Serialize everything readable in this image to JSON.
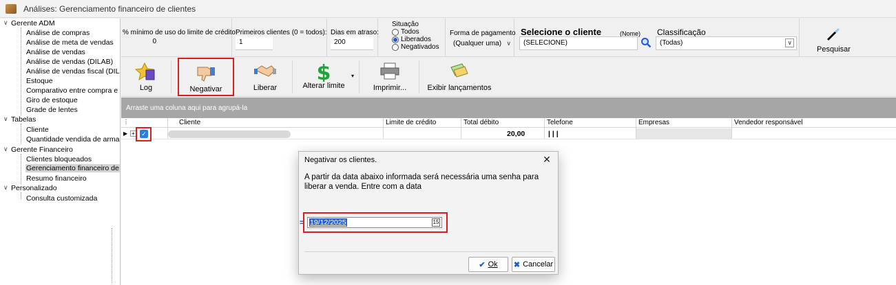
{
  "window": {
    "title": "Análises: Gerenciamento financeiro de clientes"
  },
  "tree": {
    "groups": [
      {
        "label": "Gerente ADM",
        "items": [
          "Análise de compras",
          "Análise de meta de vendas",
          "Análise de vendas",
          "Análise de vendas (DILAB)",
          "Análise de vendas fiscal (DIL",
          "Estoque",
          "Comparativo entre compra e",
          "Giro de estoque",
          "Grade de lentes"
        ]
      },
      {
        "label": "Tabelas",
        "items": [
          "Cliente",
          "Quantidade vendida de arma"
        ]
      },
      {
        "label": "Gerente Financeiro",
        "items": [
          "Clientes bloqueados",
          "Gerenciamento financeiro de",
          "Resumo financeiro"
        ]
      },
      {
        "label": "Personalizado",
        "items": [
          "Consulta customizada"
        ]
      }
    ]
  },
  "filters": {
    "limit_label": "% mínimo de uso do limite de crédito:",
    "limit_value": "0",
    "first_label": "Primeiros clientes (0 = todos):",
    "first_value": "1",
    "days_label": "Dias em atraso:",
    "days_value": "200",
    "situacao_label": "Situação",
    "situacao_options": [
      "Todos",
      "Liberados",
      "Negativados"
    ],
    "payment_label": "Forma de pagamento",
    "payment_value": "(Qualquer uma)",
    "client_title": "Selecione o cliente",
    "client_hint": "(Nome)",
    "client_value": "(SELECIONE)",
    "class_label": "Classificação",
    "class_value": "(Todas)",
    "search_label": "Pesquisar"
  },
  "toolbar": {
    "log": "Log",
    "negativar": "Negativar",
    "liberar": "Liberar",
    "alterar": "Alterar limite",
    "imprimir": "Imprimir...",
    "exibir": "Exibir lançamentos"
  },
  "grid": {
    "group_hint": "Arraste uma coluna aqui para agrupá-la",
    "columns": [
      "Cliente",
      "Limite de crédito",
      "Total débito",
      "Telefone",
      "Empresas",
      "Vendedor responsável"
    ],
    "row": {
      "total_debito": "20,00",
      "telefone": "|  |  |"
    }
  },
  "dialog": {
    "title": "Negativar os clientes.",
    "message": "A partir da data abaixo informada será necessária uma senha para liberar a venda. Entre com a data",
    "date_value": "19/12/2025",
    "ok": "Ok",
    "cancel": "Cancelar"
  },
  "colors": {
    "highlight": "#e01b1b",
    "selection": "#2a63d4",
    "group_bar": "#a6a6a6"
  }
}
